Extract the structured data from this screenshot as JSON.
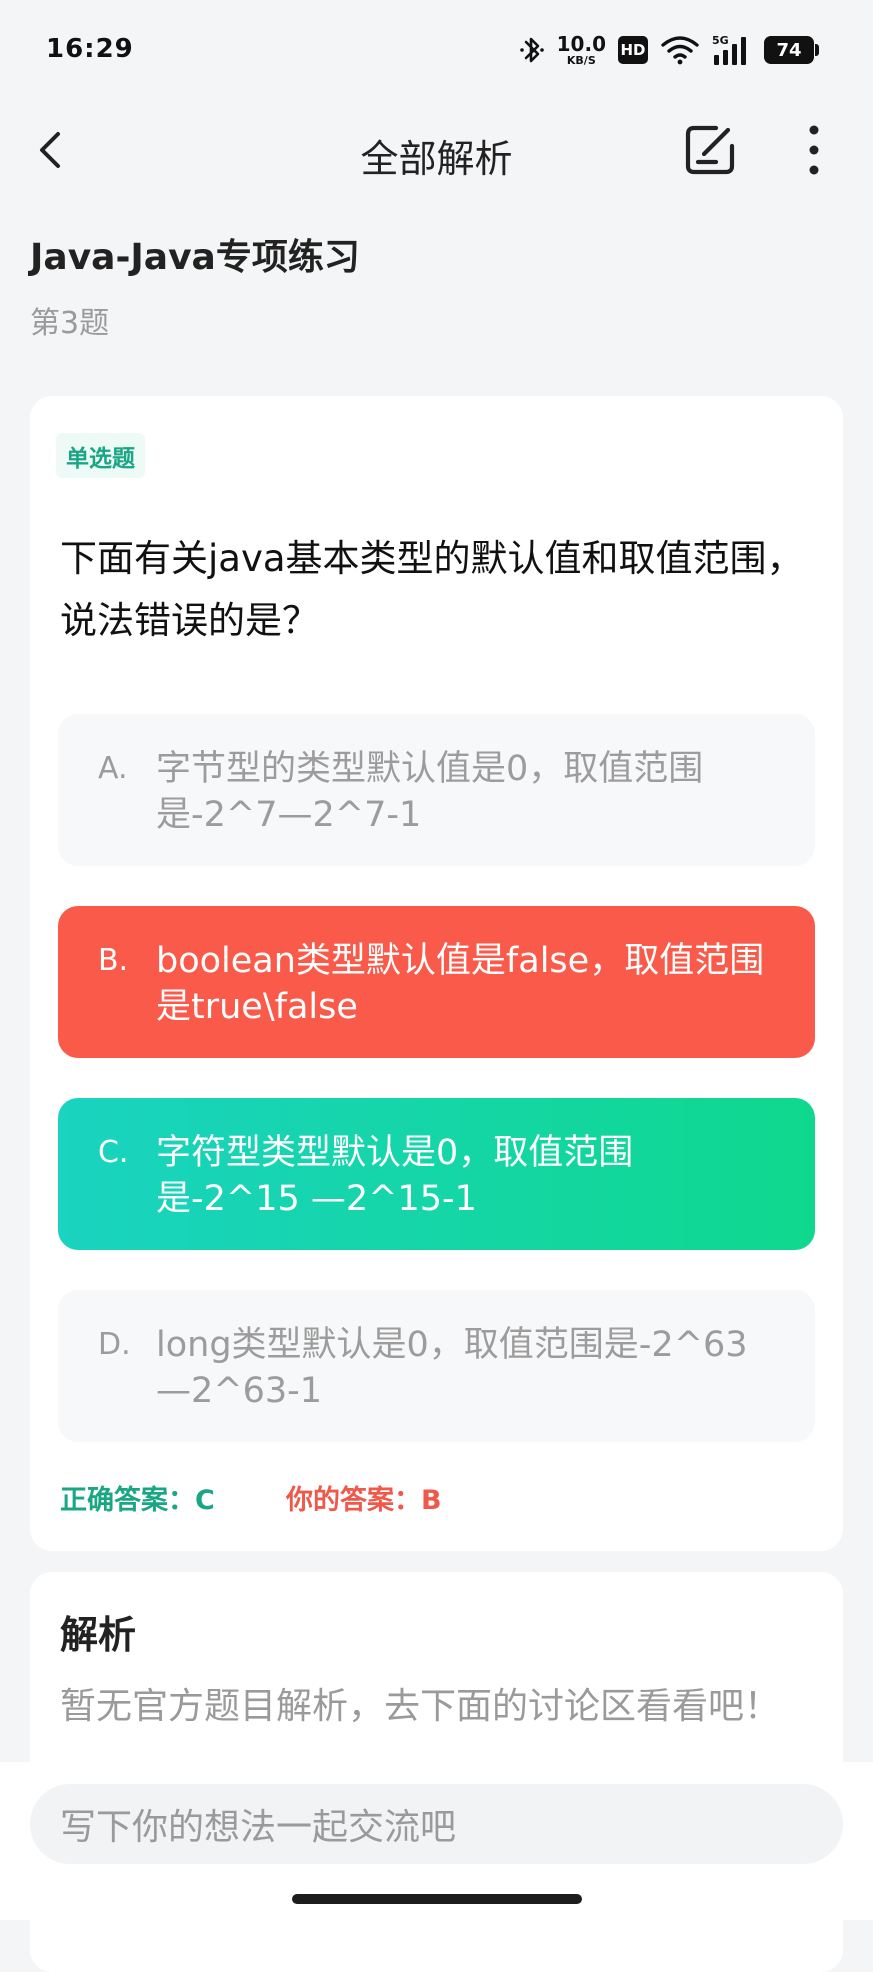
{
  "status_bar": {
    "time": "16:29",
    "net_speed_value": "10.0",
    "net_speed_unit": "KB/S",
    "hd_label": "HD",
    "battery_level": "74",
    "icons": [
      "bluetooth-icon",
      "hd-icon",
      "wifi-icon",
      "5g-signal-icon",
      "battery-icon"
    ]
  },
  "nav": {
    "title": "全部解析",
    "icons": [
      "back-icon",
      "note-edit-icon",
      "more-vertical-icon"
    ]
  },
  "header": {
    "exam_title": "Java-Java专项练习",
    "question_number": "第3题"
  },
  "question": {
    "type_label": "单选题",
    "stem": "下面有关java基本类型的默认值和取值范围，说法错误的是？",
    "options": [
      {
        "letter": "A.",
        "text": "字节型的类型默认值是0，取值范围是-2^7—2^7-1",
        "state": "neutral"
      },
      {
        "letter": "B.",
        "text": "boolean类型默认值是false，取值范围是true\\false",
        "state": "wrong-selected"
      },
      {
        "letter": "C.",
        "text": "字符型类型默认是0，取值范围是-2^15 —2^15-1",
        "state": "correct"
      },
      {
        "letter": "D.",
        "text": "long类型默认是0，取值范围是-2^63—2^63-1",
        "state": "neutral"
      }
    ],
    "correct_answer": "正确答案：C",
    "your_answer": "你的答案：B"
  },
  "analysis": {
    "title": "解析",
    "body": "暂无官方题目解析，去下面的讨论区看看吧！"
  },
  "comment": {
    "placeholder": "写下你的想法一起交流吧"
  },
  "colors": {
    "background": "#f4f5f7",
    "correct_green": "#1aa585",
    "wrong_red": "#fa5a4a",
    "correct_gradient_start": "#1ad3c0",
    "correct_gradient_end": "#0fd88e",
    "muted_text": "#9a9a9a"
  }
}
